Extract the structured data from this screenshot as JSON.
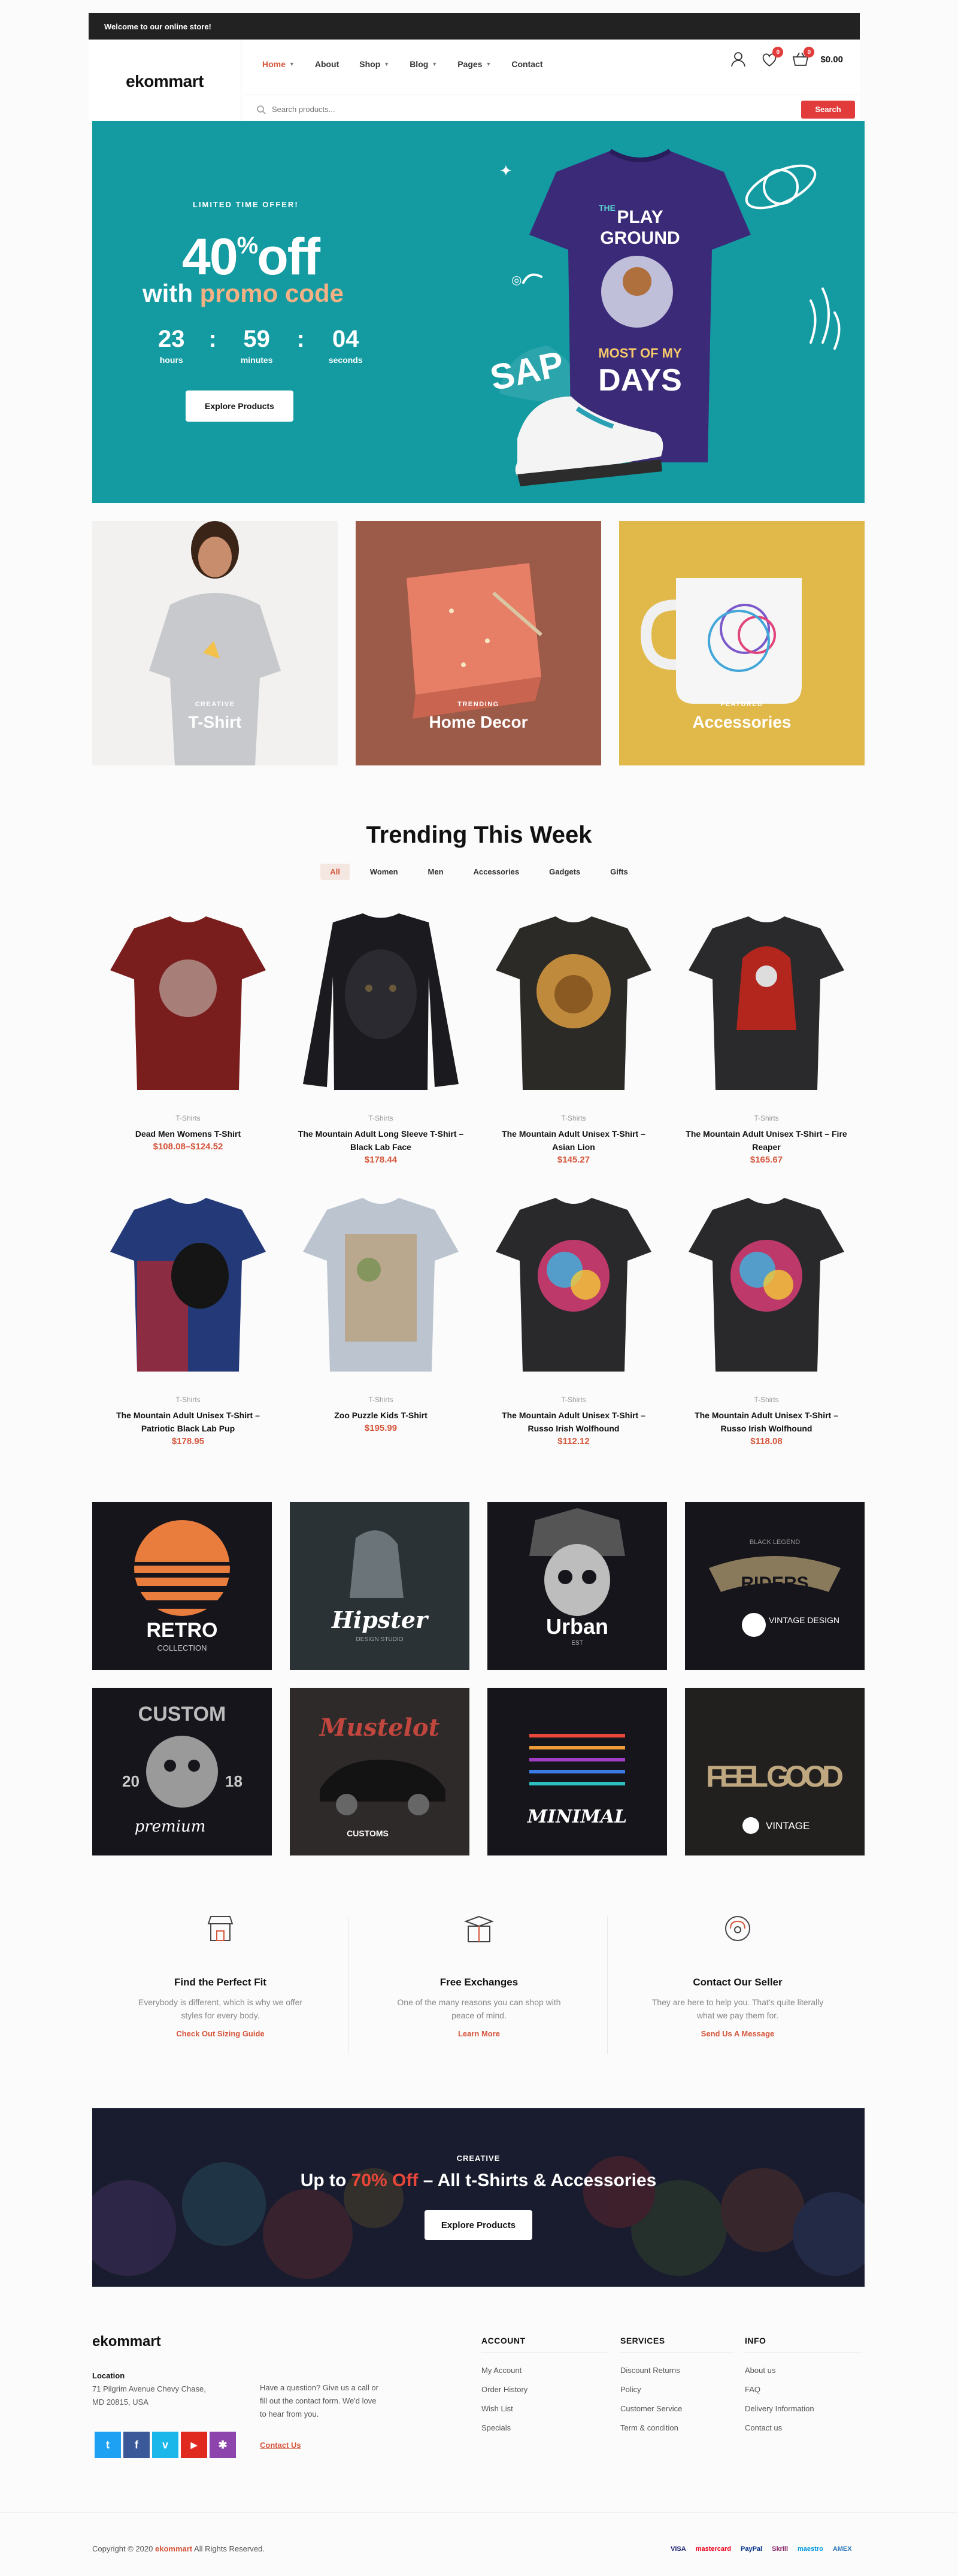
{
  "topbar": {
    "welcome": "Welcome to our online store!"
  },
  "header": {
    "logo": "ekommart",
    "nav": [
      {
        "label": "Home",
        "has_dropdown": true,
        "active": true
      },
      {
        "label": "About",
        "has_dropdown": false
      },
      {
        "label": "Shop",
        "has_dropdown": true
      },
      {
        "label": "Blog",
        "has_dropdown": true
      },
      {
        "label": "Pages",
        "has_dropdown": true
      },
      {
        "label": "Contact",
        "has_dropdown": false
      }
    ],
    "wishlist_count": "0",
    "cart_count": "0",
    "cart_total": "$0.00",
    "search_placeholder": "Search products...",
    "search_button": "Search"
  },
  "hero": {
    "eyebrow": "LIMITED TIME OFFER!",
    "discount": "40",
    "percent": "%",
    "off": "off",
    "with_text": "with",
    "promo": "promo code",
    "countdown": [
      {
        "value": "23",
        "label": "hours"
      },
      {
        "value": "59",
        "label": "minutes"
      },
      {
        "value": "04",
        "label": "seconds"
      }
    ],
    "button": "Explore Products",
    "shirt_text": [
      "THE",
      "PLAY",
      "GROUND",
      "MOST OF MY",
      "DAYS"
    ],
    "slogan": "SAP"
  },
  "categories": [
    {
      "eyebrow": "CREATIVE",
      "title": "T-Shirt"
    },
    {
      "eyebrow": "TRENDING",
      "title": "Home Decor"
    },
    {
      "eyebrow": "FEATURED",
      "title": "Accessories"
    }
  ],
  "trending": {
    "title": "Trending This Week",
    "tabs": [
      "All",
      "Women",
      "Men",
      "Accessories",
      "Gadgets",
      "Gifts"
    ],
    "products": [
      {
        "category": "T-Shirts",
        "name": "Dead Men Womens T-Shirt",
        "price": "$108.08–$124.52"
      },
      {
        "category": "T-Shirts",
        "name": "The Mountain Adult Long Sleeve T-Shirt – Black Lab Face",
        "price": "$178.44"
      },
      {
        "category": "T-Shirts",
        "name": "The Mountain Adult Unisex T-Shirt – Asian Lion",
        "price": "$145.27"
      },
      {
        "category": "T-Shirts",
        "name": "The Mountain Adult Unisex T-Shirt – Fire Reaper",
        "price": "$165.67"
      },
      {
        "category": "T-Shirts",
        "name": "The Mountain Adult Unisex T-Shirt – Patriotic Black Lab Pup",
        "price": "$178.95"
      },
      {
        "category": "T-Shirts",
        "name": "Zoo Puzzle Kids T-Shirt",
        "price": "$195.99"
      },
      {
        "category": "T-Shirts",
        "name": "The Mountain Adult Unisex T-Shirt – Russo Irish Wolfhound",
        "price": "$112.12"
      },
      {
        "category": "T-Shirts",
        "name": "The Mountain Adult Unisex T-Shirt – Russo Irish Wolfhound",
        "price": "$118.08"
      }
    ]
  },
  "designs": [
    {
      "title": "RETRO",
      "subtitle": "COLLECTION"
    },
    {
      "title": "Hipster",
      "subtitle": "DESIGN STUDIO"
    },
    {
      "title": "Urban",
      "subtitle": "EST"
    },
    {
      "title": "RIDERS",
      "subtitle": "VINTAGE DESIGN",
      "top": "BLACK LEGEND"
    },
    {
      "title": "CUSTOM",
      "subtitle": "premium",
      "year_a": "20",
      "year_b": "18"
    },
    {
      "title": "Mustelot",
      "subtitle": "CUSTOMS"
    },
    {
      "title": "MINIMAL",
      "subtitle": ""
    },
    {
      "title": "FEEL GOOD",
      "subtitle": "VINTAGE"
    }
  ],
  "features": [
    {
      "title": "Find the Perfect Fit",
      "desc": "Everybody is different, which is why we offer styles for every body.",
      "link": "Check Out Sizing Guide"
    },
    {
      "title": "Free Exchanges",
      "desc": "One of the many reasons you can shop with peace of mind.",
      "link": "Learn More"
    },
    {
      "title": "Contact Our Seller",
      "desc": "They are here to help you. That's quite literally what we pay them for.",
      "link": "Send Us A Message"
    }
  ],
  "banner": {
    "eyebrow": "CREATIVE",
    "title_pre": "Up to",
    "title_hl": "70% Off",
    "title_post": "– All t-Shirts & Accessories",
    "button": "Explore Products"
  },
  "footer": {
    "logo": "ekommart",
    "location_label": "Location",
    "address_line1": "71 Pilgrim Avenue Chevy Chase,",
    "address_line2": "MD 20815, USA",
    "question_line1": "Have a question? Give us a call or",
    "question_line2": "fill out the contact form. We'd love",
    "question_line3": "to hear from you.",
    "contact_link": "Contact Us",
    "columns": [
      {
        "heading": "ACCOUNT",
        "links": [
          "My Account",
          "Order History",
          "Wish List",
          "Specials"
        ]
      },
      {
        "heading": "SERVICES",
        "links": [
          "Discount Returns",
          "Policy",
          "Customer Service",
          "Term & condition"
        ]
      },
      {
        "heading": "INFO",
        "links": [
          "About us",
          "FAQ",
          "Delivery Information",
          "Contact us"
        ]
      }
    ],
    "social": [
      {
        "icon": "twitter-icon",
        "glyph": "t",
        "color": "#1da1f2"
      },
      {
        "icon": "facebook-icon",
        "glyph": "f",
        "color": "#3b5998"
      },
      {
        "icon": "vimeo-icon",
        "glyph": "v",
        "color": "#1ab7ea"
      },
      {
        "icon": "youtube-icon",
        "glyph": "▶",
        "color": "#e02a20"
      },
      {
        "icon": "yelp-icon",
        "glyph": "✱",
        "color": "#8e44ad"
      }
    ],
    "copyright_pre": "Copyright © 2020",
    "copyright_brand": "ekommart",
    "copyright_post": "All Rights Reserved.",
    "payments": [
      "VISA",
      "mastercard",
      "PayPal",
      "Skrill",
      "maestro",
      "AMEX"
    ]
  },
  "colors": {
    "accent": "#d5553b",
    "hero_bg": "#149ba2",
    "dark": "#222222",
    "banner_bg": "#1d2030"
  }
}
